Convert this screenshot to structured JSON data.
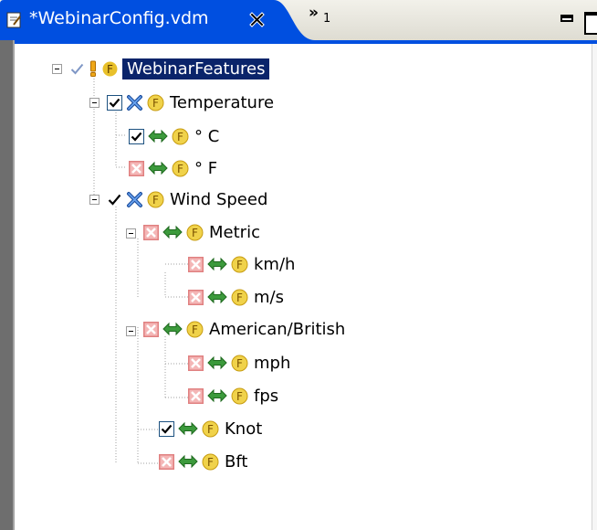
{
  "tab": {
    "title": "*WebinarConfig.vdm",
    "overflow_chevron": "»",
    "overflow_count": "1"
  },
  "colors": {
    "tab_active": "#004fe0",
    "selection": "#0a246a",
    "feature_badge": "#f0d24a",
    "check_green": "#3c9a3c",
    "deselected_red": "#e08080"
  },
  "icons": {
    "feature": "F"
  },
  "tree": {
    "root": {
      "label": "WebinarFeatures"
    },
    "temperature": {
      "label": "Temperature"
    },
    "celsius": {
      "label": "° C"
    },
    "fahrenheit": {
      "label": "° F"
    },
    "wind_speed": {
      "label": "Wind Speed"
    },
    "metric": {
      "label": "Metric"
    },
    "kmh": {
      "label": "km/h"
    },
    "ms": {
      "label": "m/s"
    },
    "american": {
      "label": "American/British"
    },
    "mph": {
      "label": "mph"
    },
    "fps": {
      "label": "fps"
    },
    "knot": {
      "label": "Knot"
    },
    "bft": {
      "label": "Bft"
    }
  }
}
